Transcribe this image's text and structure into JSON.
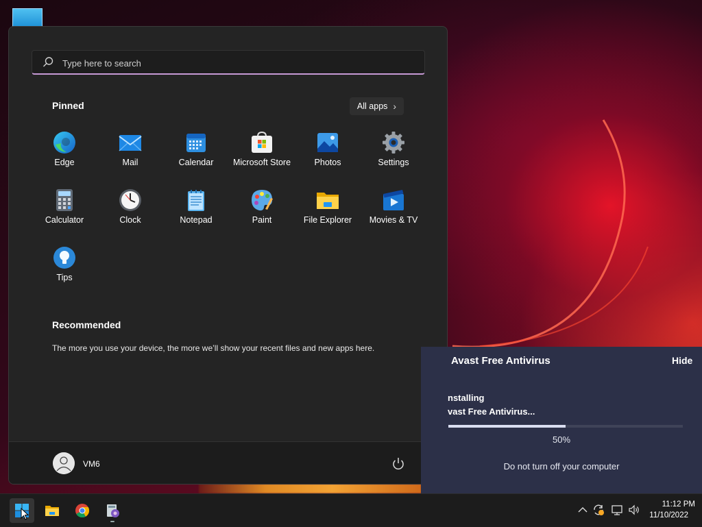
{
  "start_menu": {
    "search": {
      "placeholder": "Type here to search"
    },
    "pinned": {
      "title": "Pinned",
      "all_apps_label": "All apps",
      "apps": [
        {
          "label": "Edge",
          "icon": "edge-icon"
        },
        {
          "label": "Mail",
          "icon": "mail-icon"
        },
        {
          "label": "Calendar",
          "icon": "calendar-icon"
        },
        {
          "label": "Microsoft Store",
          "icon": "microsoft-store-icon"
        },
        {
          "label": "Photos",
          "icon": "photos-icon"
        },
        {
          "label": "Settings",
          "icon": "gear-icon"
        },
        {
          "label": "Calculator",
          "icon": "calculator-icon"
        },
        {
          "label": "Clock",
          "icon": "clock-icon"
        },
        {
          "label": "Notepad",
          "icon": "notepad-icon"
        },
        {
          "label": "Paint",
          "icon": "paint-palette-icon"
        },
        {
          "label": "File Explorer",
          "icon": "folder-icon"
        },
        {
          "label": "Movies & TV",
          "icon": "movies-tv-icon"
        },
        {
          "label": "Tips",
          "icon": "lightbulb-icon"
        }
      ]
    },
    "recommended": {
      "title": "Recommended",
      "text": "The more you use your device, the more we’ll show your recent files and new apps here."
    },
    "user": {
      "name": "VM6"
    }
  },
  "installer": {
    "title": "Avast Free Antivirus",
    "hide_label": "Hide",
    "status_line1": "nstalling",
    "status_line2": "vast Free Antivirus...",
    "progress": 0.5,
    "progress_text": "50%",
    "warning": "Do not turn off your computer",
    "accent": "#d9ddf0",
    "background": "#2c3048"
  },
  "taskbar": {
    "apps": [
      "start-icon",
      "folder-icon",
      "chrome-icon",
      "setup-installer-icon"
    ],
    "tray": [
      "chevron-up-icon",
      "update-sync-icon",
      "network-icon",
      "volume-icon"
    ],
    "clock": {
      "time": "11:12 PM",
      "date": "11/10/2022"
    }
  }
}
